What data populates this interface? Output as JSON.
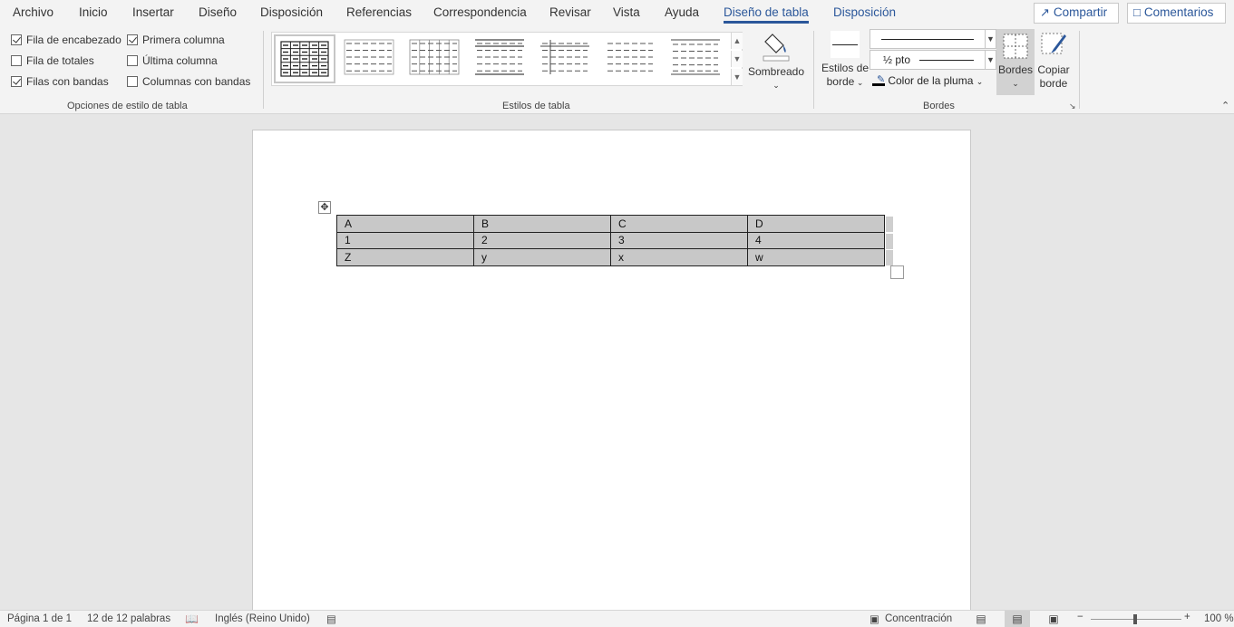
{
  "tabs": [
    {
      "label": "Archivo",
      "name": "tab-archivo"
    },
    {
      "label": "Inicio",
      "name": "tab-inicio"
    },
    {
      "label": "Insertar",
      "name": "tab-insertar"
    },
    {
      "label": "Diseño",
      "name": "tab-diseno"
    },
    {
      "label": "Disposición",
      "name": "tab-disposicion"
    },
    {
      "label": "Referencias",
      "name": "tab-referencias"
    },
    {
      "label": "Correspondencia",
      "name": "tab-correspondencia"
    },
    {
      "label": "Revisar",
      "name": "tab-revisar"
    },
    {
      "label": "Vista",
      "name": "tab-vista"
    },
    {
      "label": "Ayuda",
      "name": "tab-ayuda"
    },
    {
      "label": "Diseño de tabla",
      "name": "tab-diseno-de-tabla",
      "active": true
    },
    {
      "label": "Disposición",
      "name": "tab-disposicion-tabla"
    }
  ],
  "top_actions": {
    "share": "Compartir",
    "comments": "Comentarios"
  },
  "style_options": {
    "group_label": "Opciones de estilo de tabla",
    "items": [
      {
        "label": "Fila de encabezado",
        "checked": true
      },
      {
        "label": "Fila de totales",
        "checked": false
      },
      {
        "label": "Filas con bandas",
        "checked": true
      },
      {
        "label": "Primera columna",
        "checked": true
      },
      {
        "label": "Última columna",
        "checked": false
      },
      {
        "label": "Columnas con bandas",
        "checked": false
      }
    ]
  },
  "table_styles": {
    "group_label": "Estilos de tabla",
    "shading_label": "Sombreado"
  },
  "borders": {
    "group_label": "Bordes",
    "border_styles_line1": "Estilos de",
    "border_styles_line2": "borde",
    "pen_weight": "½ pto",
    "pen_color": "Color de la pluma",
    "borders_button": "Bordes",
    "painter_line1": "Copiar",
    "painter_line2": "borde"
  },
  "document_table": {
    "rows": [
      [
        "A",
        "B",
        "C",
        "D"
      ],
      [
        "1",
        "2",
        "3",
        "4"
      ],
      [
        "Z",
        "y",
        "x",
        "w"
      ]
    ]
  },
  "status_bar": {
    "page": "Página 1 de 1",
    "words": "12 de 12 palabras",
    "language": "Inglés (Reino Unido)",
    "focus": "Concentración",
    "zoom": "100 %"
  },
  "colors": {
    "accent": "#2b579a",
    "table_shading": "#c8c8c8"
  }
}
